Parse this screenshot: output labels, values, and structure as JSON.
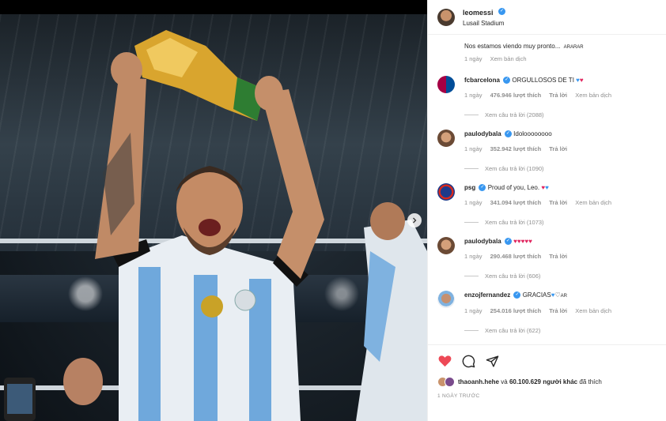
{
  "post": {
    "username": "leomessi",
    "location": "Lusail Stadium",
    "caption": {
      "text": "Nos estamos viendo muy pronto...",
      "suffix": "ARARAR",
      "time": "1 ngày",
      "translate": "Xem bản dịch"
    }
  },
  "comments": [
    {
      "user": "fcbarcelona",
      "text": "ORGULLOSOS DE TI",
      "hearts": [
        "blue",
        "red"
      ],
      "time": "1 ngày",
      "likes": "476.946 lượt thích",
      "reply": "Trả lời",
      "translate": "Xem bản dịch",
      "view_replies": "Xem câu trả lời (2088)"
    },
    {
      "user": "paulodybala",
      "text": "Idoloooooooo",
      "hearts": [],
      "time": "1 ngày",
      "likes": "352.942 lượt thích",
      "reply": "Trả lời",
      "translate": "",
      "view_replies": "Xem câu trả lời (1090)"
    },
    {
      "user": "psg",
      "text": "Proud of you, Leo.",
      "hearts": [
        "red",
        "blue"
      ],
      "time": "1 ngày",
      "likes": "341.094 lượt thích",
      "reply": "Trả lời",
      "translate": "Xem bản dịch",
      "view_replies": "Xem câu trả lời (1073)"
    },
    {
      "user": "paulodybala",
      "text": "",
      "hearts": [
        "red",
        "red",
        "red",
        "red",
        "red"
      ],
      "time": "1 ngày",
      "likes": "290.468 lượt thích",
      "reply": "Trả lời",
      "translate": "",
      "view_replies": "Xem câu trả lời (606)"
    },
    {
      "user": "enzojfernandez",
      "text": "GRACIAS",
      "hearts": [
        "blue",
        "white"
      ],
      "suffix": "AR",
      "time": "1 ngày",
      "likes": "254.016 lượt thích",
      "reply": "Trả lời",
      "translate": "Xem bản dịch",
      "view_replies": "Xem câu trả lời (622)"
    }
  ],
  "footer": {
    "liker": "thaoanh.hehe",
    "and": "và",
    "others": "60.100.629 người khác",
    "liked": "đã thích",
    "timestamp": "1 NGÀY TRƯỚC"
  },
  "icons": {
    "like": "heart-filled-icon",
    "comment": "comment-icon",
    "share": "share-icon",
    "next": "chevron-right-icon"
  },
  "colors": {
    "like_red": "#ed4956",
    "verified_blue": "#3897f0",
    "muted_gray": "#8e8e8e"
  }
}
